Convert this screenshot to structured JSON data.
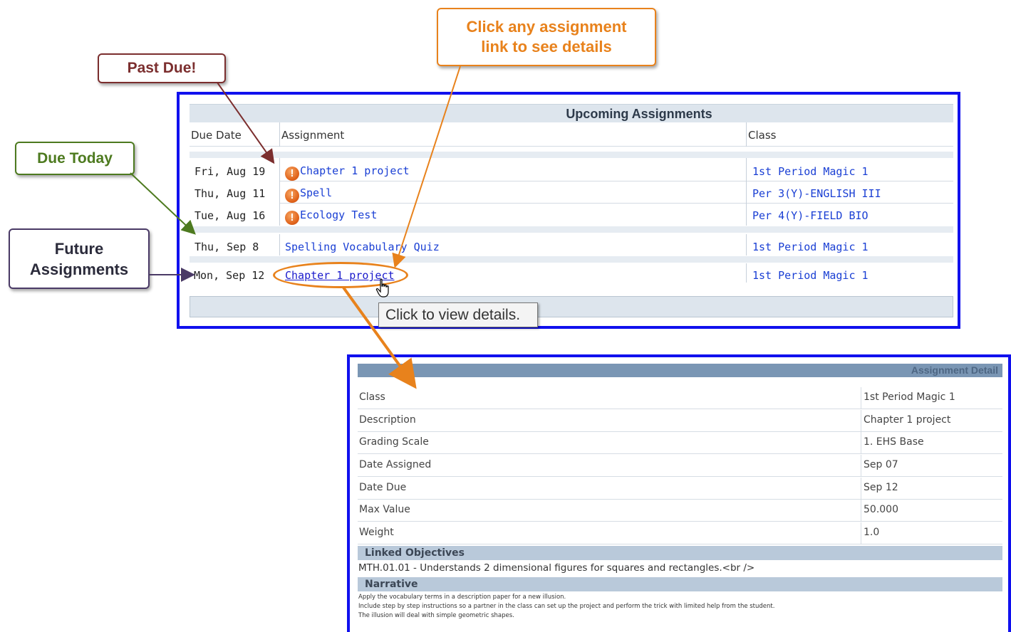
{
  "callouts": {
    "past_due": "Past Due!",
    "click_any_line1": "Click any assignment",
    "click_any_line2": "link to see details",
    "due_today": "Due Today",
    "future_line1": "Future",
    "future_line2": "Assignments"
  },
  "upcoming": {
    "title": "Upcoming Assignments",
    "headers": {
      "due_date": "Due Date",
      "assignment": "Assignment",
      "class": "Class"
    },
    "past_due_rows": [
      {
        "date": "Fri, Aug 19",
        "assignment": "Chapter 1 project",
        "class": "1st Period Magic 1"
      },
      {
        "date": "Thu, Aug 11",
        "assignment": "Spell",
        "class": "Per 3(Y)-ENGLISH III"
      },
      {
        "date": "Tue, Aug 16",
        "assignment": "Ecology Test",
        "class": "Per 4(Y)-FIELD BIO"
      }
    ],
    "today_row": {
      "date": "Thu, Sep 8",
      "assignment": "Spelling Vocabulary Quiz",
      "class": "1st Period Magic 1"
    },
    "future_row": {
      "date": "Mon, Sep 12",
      "assignment": "Chapter 1 project",
      "class": "1st Period Magic 1"
    },
    "warning_icon": "exclamation-icon",
    "tooltip": "Click to view details."
  },
  "detail": {
    "title": "Assignment Detail",
    "rows": [
      {
        "label": "Class",
        "value": "1st Period Magic 1"
      },
      {
        "label": "Description",
        "value": "Chapter 1 project"
      },
      {
        "label": "Grading Scale",
        "value": "1. EHS Base"
      },
      {
        "label": "Date Assigned",
        "value": "Sep 07"
      },
      {
        "label": "Date Due",
        "value": "Sep 12"
      },
      {
        "label": "Max Value",
        "value": "50.000"
      },
      {
        "label": "Weight",
        "value": "1.0"
      }
    ],
    "linked_objectives_title": "Linked Objectives",
    "linked_objective": "MTH.01.01 - Understands 2 dimensional figures for squares and rectangles.<br />",
    "narrative_title": "Narrative",
    "narrative_lines": [
      "Apply the vocabulary terms in a description paper for a new illusion.",
      "Include step by step instructions so a partner in the class can set up the project and perform the trick with limited help from the student.",
      "The illusion will deal with simple geometric shapes."
    ]
  },
  "colors": {
    "frame_blue": "#1010ee",
    "link_blue": "#1a3fd4",
    "orange": "#e8821c",
    "past_due_red": "#7b2e2e",
    "due_today_green": "#4d7a1f",
    "future_purple": "#4a3a66"
  }
}
